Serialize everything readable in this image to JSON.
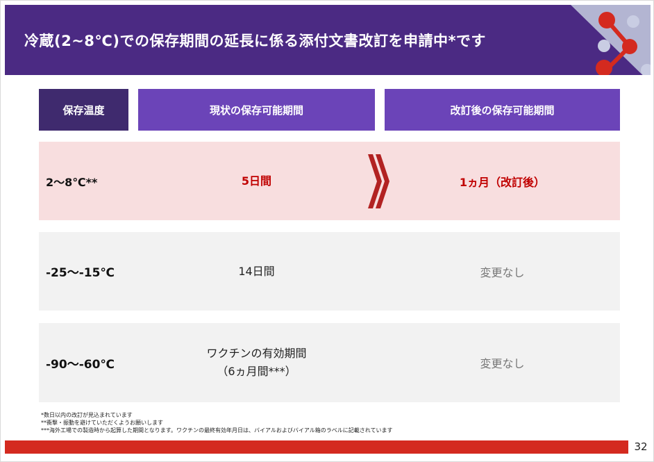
{
  "header": {
    "title": "冷蔵(2~8℃)での保存期間の延長に係る添付文書改訂を申請中*です",
    "logo": "molecule-logo",
    "colors": {
      "background": "#4b2a83",
      "accent": "#d42a1f"
    }
  },
  "table": {
    "headers": {
      "temperature": "保存温度",
      "current": "現状の保存可能期間",
      "revised": "改訂後の保存可能期間"
    },
    "rows": [
      {
        "temperature": "2～8℃**",
        "current": "5日間",
        "revised": "1ヵ月（改訂後）",
        "highlight": true
      },
      {
        "temperature": "-25～-15℃",
        "current": "14日間",
        "revised": "変更なし"
      },
      {
        "temperature": "-90～-60℃",
        "current_line1": "ワクチンの有効期間",
        "current_line2": "（6ヵ月間***）",
        "revised": "変更なし"
      }
    ],
    "arrow_icon": "double-chevron-right-icon",
    "colors": {
      "highlight_row": "#f8dedf",
      "plain_row": "#f2f2f2",
      "highlight_text": "#c00000"
    }
  },
  "footnotes": [
    "*数日以内の改訂が見込まれています",
    "**衝撃・振動を避けていただくようお願いします",
    "***海外工場での製造時から起算した期間となります。ワクチンの最終有効年月日は、バイアルおよびバイアル箱のラベルに記載されています"
  ],
  "page_number": "32"
}
